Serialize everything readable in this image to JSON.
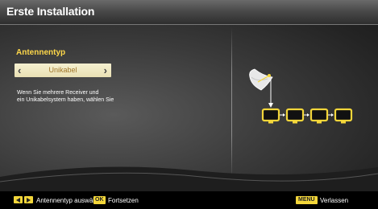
{
  "window": {
    "title": "Erste Installation"
  },
  "antenna": {
    "label": "Antennentyp",
    "selected_value": "Unikabel",
    "left_arrow": "‹",
    "right_arrow": "›"
  },
  "help": {
    "line1": "Wenn Sie mehrere Receiver und",
    "line2": "ein Unikabelsystem haben, wählen Sie"
  },
  "footer": {
    "navigate_text": "Antennentyp auswählen",
    "ok_key": "OK",
    "ok_text": "Fortsetzen",
    "menu_key": "MENU",
    "menu_text": "Verlassen"
  },
  "colors": {
    "accent_yellow": "#ffd84a",
    "key_yellow": "#f3d63a",
    "selector_bg": "#f0e8c0",
    "selector_text": "#a0762a"
  },
  "icons": [
    "left-arrow-icon",
    "right-arrow-icon",
    "satellite-dish-icon",
    "receiver-tv-icon"
  ]
}
